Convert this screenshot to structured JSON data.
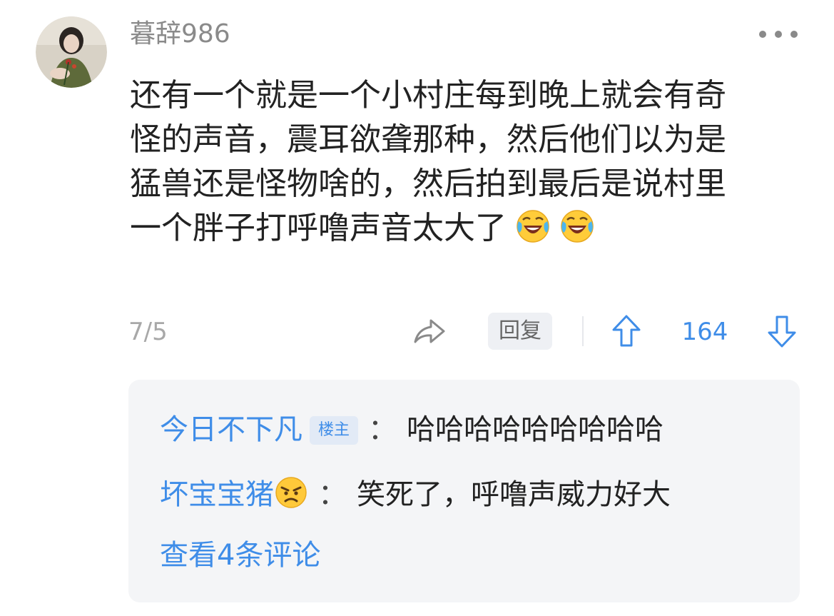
{
  "comment": {
    "username": "暮辞986",
    "lines": [
      "还有一个就是一个小村庄每到晚上就会有奇",
      "怪的声音，震耳欲聋那种，然后他们以为是",
      "猛兽还是怪物啥的，然后拍到最后是说村里",
      "一个胖子打呼噜声音太大了"
    ],
    "date": "7/5",
    "reply_label": "回复",
    "vote_count": "164"
  },
  "replies": {
    "items": [
      {
        "name": "今日不下凡",
        "badge": "楼主",
        "separator": "：",
        "text": "哈哈哈哈哈哈哈哈哈"
      },
      {
        "name": "坏宝宝猪",
        "separator": "：",
        "text": "笑死了，呼噜声威力好大"
      }
    ],
    "view_all": "查看4条评论"
  },
  "colors": {
    "accent": "#3f8de8",
    "body_text": "#222222",
    "muted": "#8a8a8a",
    "reply_bg": "#f4f5f7"
  },
  "icons": [
    "more-icon",
    "laughing-tears-emoji",
    "share-icon",
    "upvote-arrow-icon",
    "downvote-arrow-icon",
    "angry-face-emoji"
  ]
}
